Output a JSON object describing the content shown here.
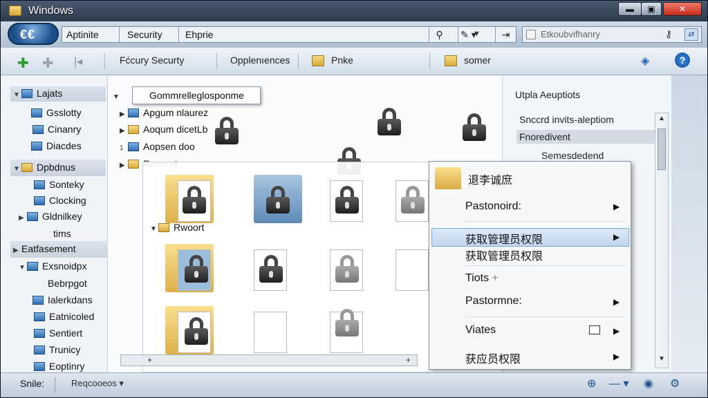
{
  "window": {
    "title": "Windows",
    "min": "▬",
    "max": "▣",
    "close": "✕"
  },
  "nav_logo": "€€",
  "address": {
    "crumbs": [
      "Aptinite",
      "Security",
      "Ehprie"
    ],
    "search_placeholder": "Etkoubvifhanry"
  },
  "toolbar": {
    "label1": "Fćcury Securty",
    "label2": "Opplenıences",
    "label3": "Pnke",
    "label4": "somer"
  },
  "sidebar": {
    "items": [
      {
        "label": "Lajats"
      },
      {
        "label": "Gsslotty"
      },
      {
        "label": "Cinanry"
      },
      {
        "label": "Diacdes"
      },
      {
        "label": "Dpbdnus"
      },
      {
        "label": "Sonteky"
      },
      {
        "label": "Clocking"
      },
      {
        "label": "Gldnilkey"
      },
      {
        "label": "tims"
      },
      {
        "label": "Eatfasement"
      },
      {
        "label": "Exsnoidpx"
      },
      {
        "label": "Bebrpgot"
      },
      {
        "label": "Ialerkdans"
      },
      {
        "label": "Eatnicoled"
      },
      {
        "label": "Sentiert"
      },
      {
        "label": "Trunicy"
      },
      {
        "label": "Eoptinry"
      }
    ]
  },
  "tree": {
    "tooltip": "Gommrelleglosponme",
    "rows": [
      "Apgum nlaurez",
      "Aoqum dicetLb",
      "Aopsen doo",
      "Rnmmrt",
      "Rwoort"
    ],
    "rownum": "1"
  },
  "preview": {
    "title": "Utpla Aeuptiots",
    "lines": [
      "Snccrd invits-aleptiom",
      "Fnoredivent",
      "Semesdedend"
    ]
  },
  "context_menu": {
    "header": "退李诚庶",
    "items": [
      "Pastonoird:",
      "获取管理员权限",
      "获取管理员权限",
      "Tiots",
      "Pastormne:",
      "Viates",
      "获应员权限"
    ],
    "tiots_plus": "+"
  },
  "status": {
    "label": "Snile:",
    "value": "Reqcooeos"
  }
}
